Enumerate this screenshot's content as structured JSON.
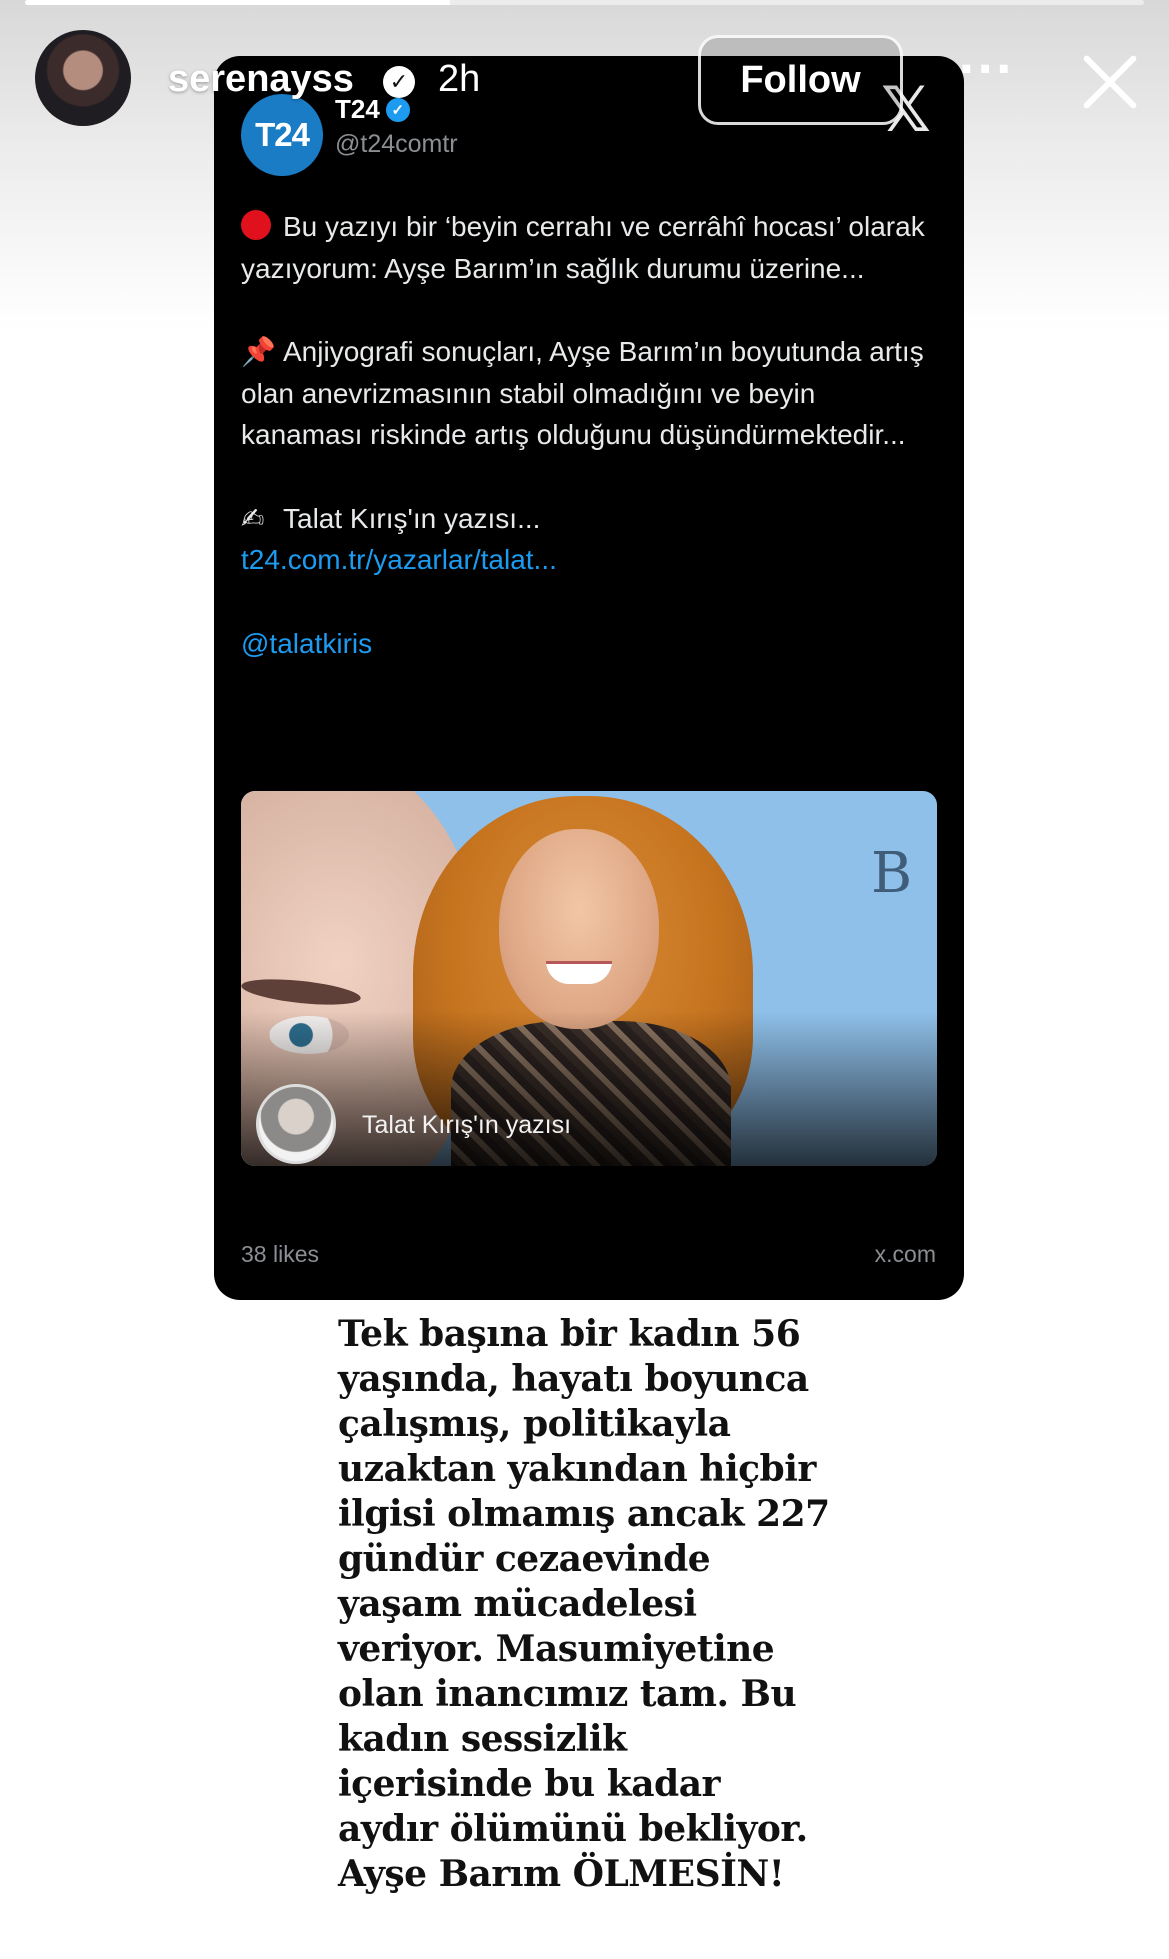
{
  "story": {
    "progress": 0.38,
    "username": "serenayss",
    "time_ago": "2h",
    "follow_label": "Follow",
    "more_icon": "more-horizontal-icon",
    "close_icon": "close-icon"
  },
  "tweet": {
    "account_logo": "T24",
    "account_name": "T24",
    "handle": "@t24comtr",
    "paragraph1": "Bu yazıyı bir ‘beyin cerrahı ve cerrâhî hocası’ olarak yazıyorum: Ayşe Barım’ın sağlık durumu üzerine...",
    "paragraph2": "Anjiyografi sonuçları, Ayşe Barım’ın boyutunda artış olan anevrizmasının stabil olmadığını ve beyin kanaması riskinde artış olduğunu düşündürmektedir...",
    "paragraph3": "Talat Kırış'ın yazısı...",
    "link": "t24.com.tr/yazarlar/talat...",
    "mention": "@talatkiris",
    "media_letter": "B",
    "media_caption": "Talat Kırış'ın yazısı",
    "likes": "38 likes",
    "source": "x.com",
    "emoji_pin": "📌",
    "emoji_write": "✍"
  },
  "story_text": {
    "lines": [
      "Tek başına bir kadın 56",
      "yaşında,  hayatı boyunca",
      "çalışmış, politikayla",
      "uzaktan yakından hiçbir",
      "ilgisi olmamış ancak 227",
      "gündür cezaevinde",
      "yaşam mücadelesi",
      "veriyor. Masumiyetine",
      "olan inancımız tam. Bu",
      "kadın sessizlik",
      "içerisinde bu kadar",
      "aydır ölümünü bekliyor.",
      "Ayşe Barım ÖLMESİN!"
    ]
  },
  "colors": {
    "tweet_link": "#1d9bf0",
    "t24_logo": "#1a7cc4",
    "card_bg": "#000000"
  }
}
